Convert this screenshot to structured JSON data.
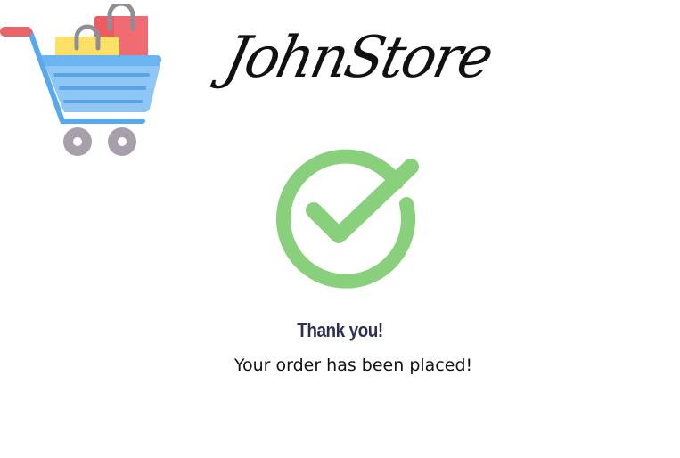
{
  "header": {
    "logo_icon": "shopping-cart-icon",
    "brand_name": "JohnStore"
  },
  "confirmation": {
    "status_icon": "check-circle-icon",
    "colors": {
      "check": "#89d07d",
      "title": "#2f2f54"
    },
    "title": "Thank you!",
    "message": "Your order has been placed!"
  }
}
